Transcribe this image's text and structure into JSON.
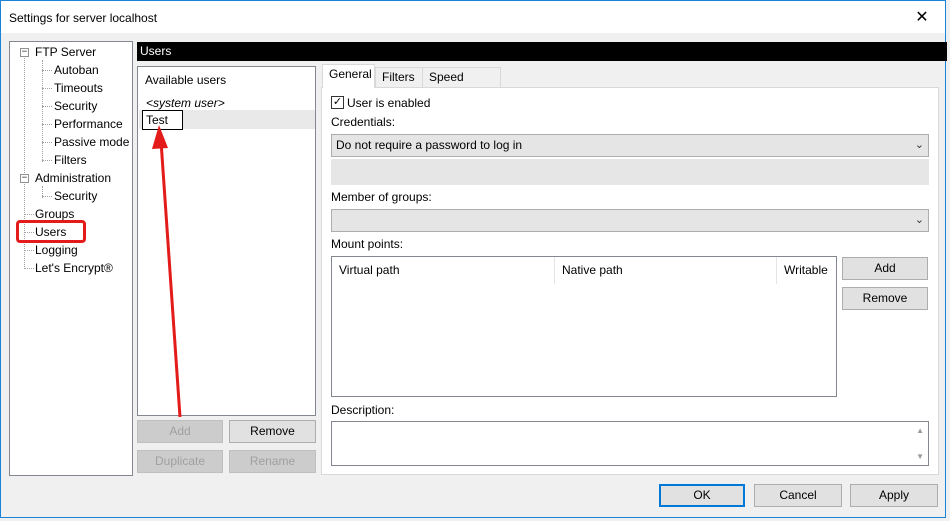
{
  "window": {
    "title": "Settings for server localhost"
  },
  "tree": {
    "ftp_server": "FTP Server",
    "autoban": "Autoban",
    "timeouts": "Timeouts",
    "security": "Security",
    "performance": "Performance",
    "passive_mode": "Passive mode",
    "filters": "Filters",
    "administration": "Administration",
    "admin_security": "Security",
    "groups": "Groups",
    "users": "Users",
    "logging": "Logging",
    "lets_encrypt": "Let's Encrypt®"
  },
  "section_title": "Users",
  "userlist": {
    "header": "Available users",
    "system_user": "<system user>",
    "editing_value": "Test"
  },
  "userlist_buttons": {
    "add": "Add",
    "remove": "Remove",
    "duplicate": "Duplicate",
    "rename": "Rename"
  },
  "tabs": [
    "General",
    "Filters",
    "Speed Limits"
  ],
  "general": {
    "user_enabled_label": "User is enabled",
    "user_enabled_checked": true,
    "credentials_label": "Credentials:",
    "credentials_value": "Do not require a password to log in",
    "groups_label": "Member of groups:",
    "groups_value": "",
    "mount_points_label": "Mount points:",
    "mount_columns": [
      "Virtual path",
      "Native path",
      "Writable"
    ],
    "mount_add": "Add",
    "mount_remove": "Remove",
    "description_label": "Description:"
  },
  "footer": {
    "ok": "OK",
    "cancel": "Cancel",
    "apply": "Apply"
  },
  "icons": {
    "close": "✕",
    "checkmark": "✓",
    "dropdown": "chevron-down-icon",
    "collapse": "−"
  },
  "colors": {
    "highlight_box": "#e31b1b",
    "arrow": "#e31b1b",
    "focus": "#0078d7"
  }
}
